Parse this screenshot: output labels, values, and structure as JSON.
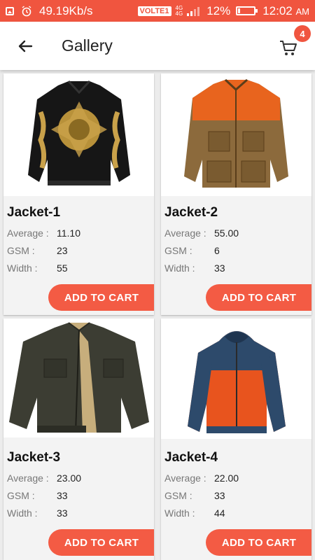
{
  "status_bar": {
    "speed": "49.19Kb/s",
    "volte": "VOLTE",
    "volte_sim": "1",
    "net_top": "4G",
    "net_bottom": "4G",
    "battery": "12%",
    "time": "12:02",
    "ampm": "AM"
  },
  "app_bar": {
    "title": "Gallery",
    "cart_count": "4"
  },
  "labels": {
    "average": "Average :",
    "gsm": "GSM :",
    "width": "Width :",
    "add_to_cart": "ADD TO CART"
  },
  "products": [
    {
      "name": "Jacket-1",
      "average": "11.10",
      "gsm": "23",
      "width": "55",
      "image_icon": "black-gold-bomber-jacket"
    },
    {
      "name": "Jacket-2",
      "average": "55.00",
      "gsm": "6",
      "width": "33",
      "image_icon": "brown-orange-hunting-jacket"
    },
    {
      "name": "Jacket-3",
      "average": "23.00",
      "gsm": "33",
      "width": "33",
      "image_icon": "dark-green-field-jacket"
    },
    {
      "name": "Jacket-4",
      "average": "22.00",
      "gsm": "33",
      "width": "44",
      "image_icon": "orange-navy-rain-jacket"
    }
  ],
  "colors": {
    "accent": "#f0553f",
    "button": "#f35b44"
  }
}
